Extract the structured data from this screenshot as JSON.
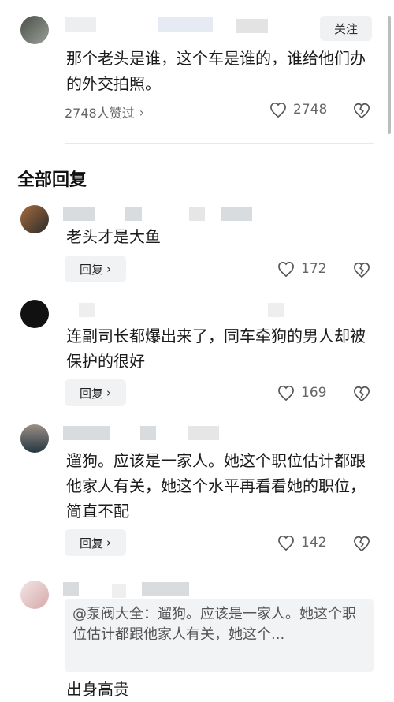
{
  "top_comment": {
    "follow_label": "关注",
    "text": "那个老头是谁，这个车是谁的，谁给他们办的外交拍照。",
    "liked_by": "2748人赞过",
    "likes": "2748"
  },
  "section_title": "全部回复",
  "replies": [
    {
      "text": "老头才是大鱼",
      "reply_label": "回复",
      "likes": "172"
    },
    {
      "text": "连副司长都爆出来了，同车牵狗的男人却被保护的很好",
      "reply_label": "回复",
      "likes": "169"
    },
    {
      "text": "遛狗。应该是一家人。她这个职位估计都跟他家人有关，她这个水平再看看她的职位，简直不配",
      "reply_label": "回复",
      "likes": "142"
    },
    {
      "quote": "@泵阀大全：遛狗。应该是一家人。她这个职位估计都跟他家人有关，她这个...",
      "text": "出身高贵"
    }
  ],
  "colors": {
    "heart_outline": "#555555",
    "button_bg": "#f1f2f4"
  }
}
